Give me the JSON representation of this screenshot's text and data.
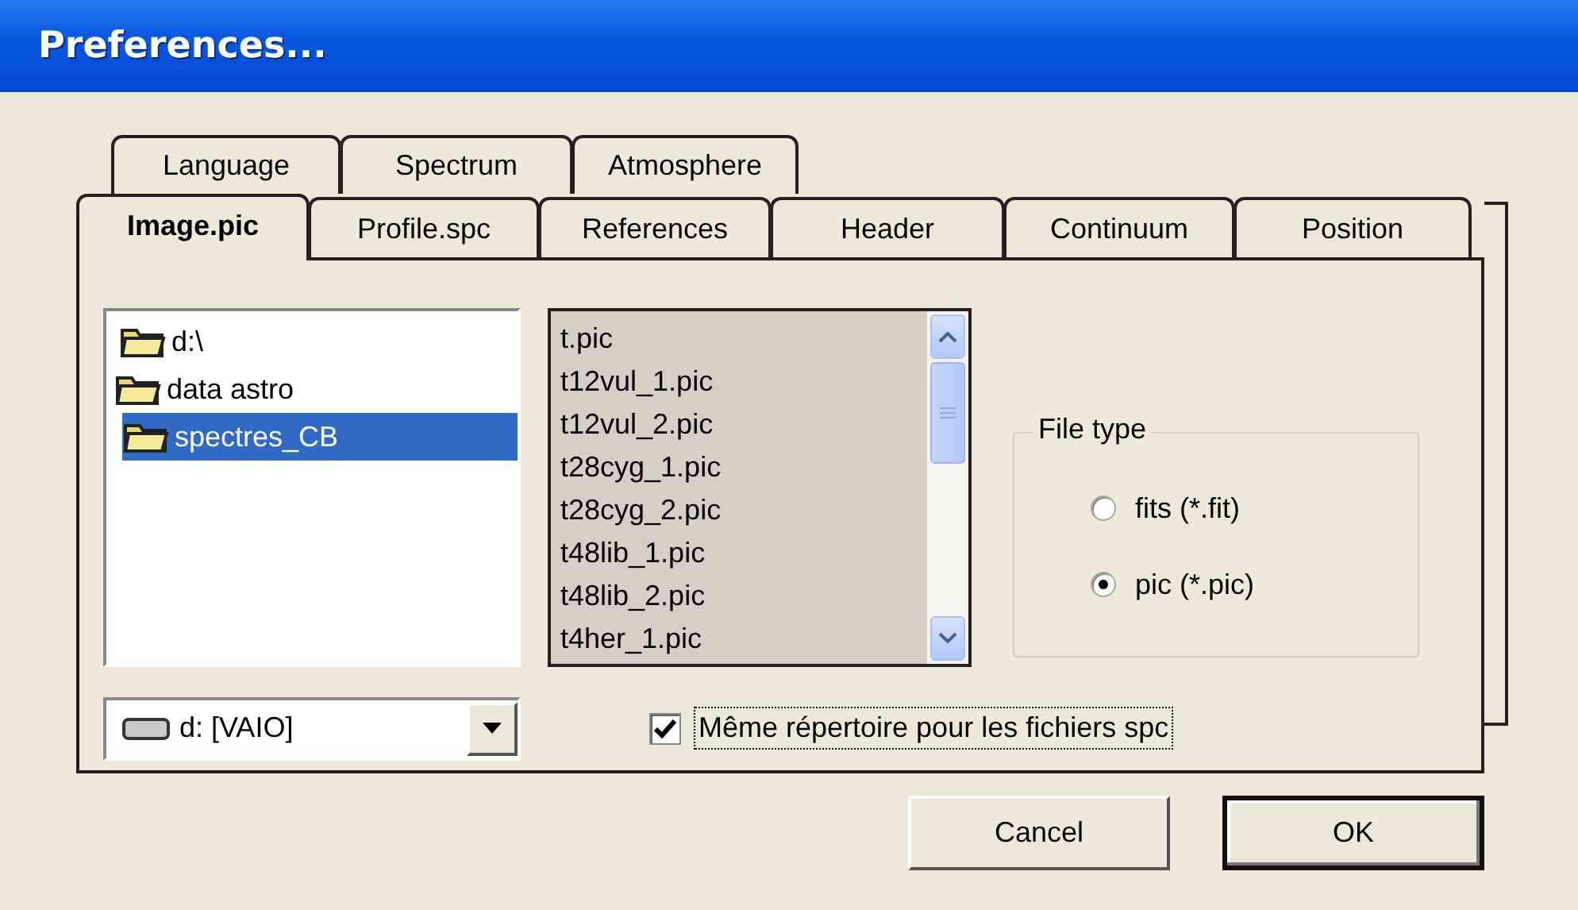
{
  "window": {
    "title": "Preferences..."
  },
  "tab_rows": [
    {
      "tabs": [
        {
          "label": "Language",
          "selected": false
        },
        {
          "label": "Spectrum",
          "selected": false
        },
        {
          "label": "Atmosphere",
          "selected": false
        }
      ]
    },
    {
      "tabs": [
        {
          "label": "Image.pic",
          "selected": true
        },
        {
          "label": "Profile.spc",
          "selected": false
        },
        {
          "label": "References",
          "selected": false
        },
        {
          "label": "Header",
          "selected": false
        },
        {
          "label": "Continuum",
          "selected": false
        },
        {
          "label": "Position",
          "selected": false
        }
      ]
    }
  ],
  "folder_tree": {
    "items": [
      {
        "label": "d:\\",
        "selected": false,
        "children": [
          {
            "label": "data astro",
            "selected": false,
            "children": [
              {
                "label": "spectres_CB",
                "selected": true
              }
            ]
          }
        ]
      }
    ]
  },
  "file_list": {
    "items": [
      "t.pic",
      "t12vul_1.pic",
      "t12vul_2.pic",
      "t28cyg_1.pic",
      "t28cyg_2.pic",
      "t48lib_1.pic",
      "t48lib_2.pic",
      "t4her_1.pic"
    ]
  },
  "drive": {
    "value": "d: [VAIO]"
  },
  "same_folder_option": {
    "label": "Même répertoire pour les fichiers spc",
    "checked": true
  },
  "file_type": {
    "title": "File type",
    "options": [
      {
        "label": "fits (*.fit)",
        "selected": false
      },
      {
        "label": "pic (*.pic)",
        "selected": true
      }
    ]
  },
  "buttons": [
    {
      "label": "Cancel",
      "default": false
    },
    {
      "label": "OK",
      "default": true
    }
  ]
}
